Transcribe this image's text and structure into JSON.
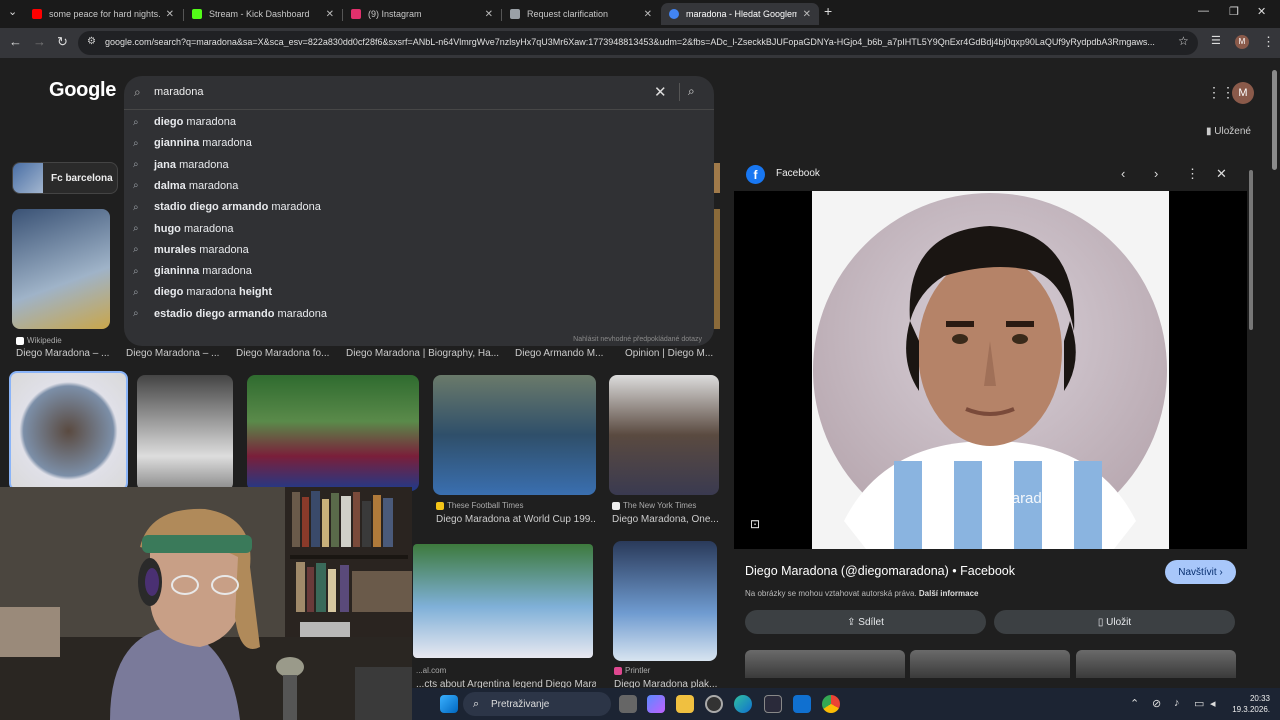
{
  "tabs": [
    {
      "title": "some peace for hard nights... (n",
      "color": "#ff0000"
    },
    {
      "title": "Stream - Kick Dashboard",
      "color": "#53fc18"
    },
    {
      "title": "(9) Instagram",
      "color": "#e1306c"
    },
    {
      "title": "Request clarification",
      "color": "#9aa0a6"
    },
    {
      "title": "maradona - Hledat Googlem",
      "color": "#4285f4"
    }
  ],
  "window_controls": {
    "minimize": "—",
    "restore": "❐",
    "close": "✕",
    "new_tab": "+"
  },
  "address_bar": {
    "url": "google.com/search?q=maradona&sa=X&sca_esv=822a830dd0cf28f6&sxsrf=ANbL-n64VlmrgWve7nzlsyHx7qU3Mr6Xaw:1773948813453&udm=2&fbs=ADc_l-ZseckkBJUFopaGDNYa-HGjo4_b6b_a7pIHTL5Y9QnExr4GdBdj4bj0qxp90LaQUf9yRydpdbA3Rmgaws..."
  },
  "google": {
    "logo": "Google",
    "query": "maradona",
    "report_link": "Nahlásit nevhodné předpokládané dotazy",
    "saved_label": "Uložené",
    "avatar_letter": "M"
  },
  "suggestions": [
    {
      "bold": "diego",
      "rest": " maradona",
      "bold_after": ""
    },
    {
      "bold": "giannina",
      "rest": " maradona",
      "bold_after": ""
    },
    {
      "bold": "jana",
      "rest": " maradona",
      "bold_after": ""
    },
    {
      "bold": "dalma",
      "rest": " maradona",
      "bold_after": ""
    },
    {
      "bold": "stadio diego armando",
      "rest": " maradona",
      "bold_after": ""
    },
    {
      "bold": "hugo",
      "rest": " maradona",
      "bold_after": ""
    },
    {
      "bold": "murales",
      "rest": " maradona",
      "bold_after": ""
    },
    {
      "bold": "gianinna",
      "rest": " maradona",
      "bold_after": ""
    },
    {
      "bold": "diego",
      "rest": " maradona ",
      "bold_after": "height"
    },
    {
      "bold": "estadio diego armando",
      "rest": " maradona",
      "bold_after": ""
    }
  ],
  "chip": {
    "label": "Fc barcelona"
  },
  "row1_captions": [
    {
      "source": "Wikipedie",
      "title": "Diego Maradona – ..."
    },
    {
      "source": "",
      "title": "Diego Maradona – ..."
    },
    {
      "source": "",
      "title": "Diego Maradona fo..."
    },
    {
      "source": "",
      "title": "Diego Maradona | Biography, Ha..."
    },
    {
      "source": "",
      "title": "Diego Armando M..."
    },
    {
      "source": "",
      "title": "Opinion | Diego M..."
    }
  ],
  "row2_captions": [
    {
      "source": "These Football Times",
      "title": "Diego Maradona at World Cup 199..."
    },
    {
      "source": "The New York Times",
      "title": "Diego Maradona, One..."
    }
  ],
  "row3_captions": [
    {
      "source": "...al.com",
      "title": "...cts about Argentina legend Diego Marad..."
    },
    {
      "source": "Printler",
      "title": "Diego Maradona plak..."
    }
  ],
  "panel": {
    "source": "Facebook",
    "watermark": "@maradona",
    "title": "Diego Maradona (@diegomaradona) • Facebook",
    "visit_label": "Navštívit ›",
    "copyright": "Na obrázky se mohou vztahovat autorská práva.",
    "more_info": "Další informace",
    "share_label": "Sdílet",
    "save_label": "Uložit"
  },
  "taskbar": {
    "search_label": "Pretraživanje",
    "time": "20:33",
    "date": "19.3.2026."
  }
}
